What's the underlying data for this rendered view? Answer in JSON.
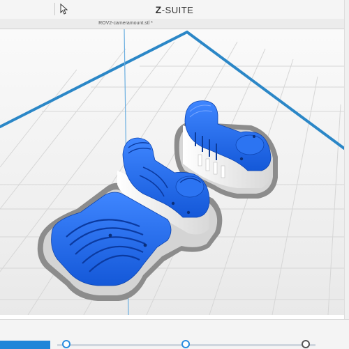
{
  "titlebar": {
    "app_title_prefix": "Z",
    "app_title_suffix": "-SUITE"
  },
  "tabbar": {
    "file_tab": "ROV2-cameramount.stl *"
  },
  "viewport": {
    "bed_border_color": "#2b87c7",
    "model_color": "#1f6fe8",
    "support_color": "#f0f0f0",
    "raft_color": "#8c8c8c"
  },
  "footer": {
    "action_label": "",
    "slider_stops": 3
  }
}
